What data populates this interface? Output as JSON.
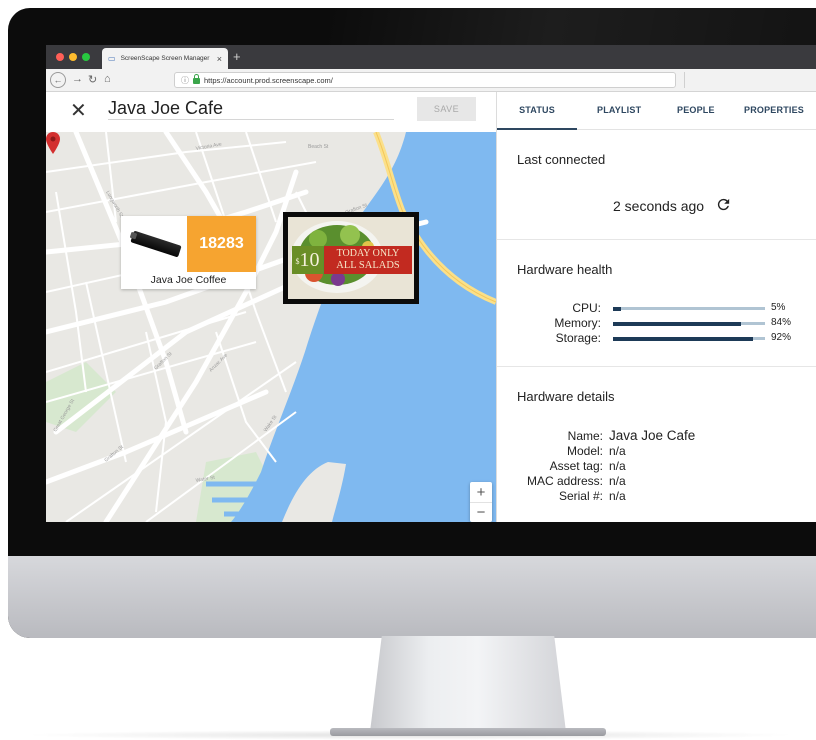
{
  "browser": {
    "tab_title": "ScreenScape Screen Manager",
    "url": "https://account.prod.screenscape.com/"
  },
  "editor": {
    "screen_name": "Java Joe Cafe",
    "save_label": "SAVE"
  },
  "map": {
    "location_card": {
      "count": "18283",
      "name": "Java Joe Coffee"
    },
    "sign": {
      "price_sup": "$",
      "price": "10",
      "line1": "TODAY ONLY",
      "line2": "ALL SALADS"
    },
    "zoom_in": "+",
    "zoom_out": "−"
  },
  "tabs": [
    {
      "label": "STATUS",
      "active": true
    },
    {
      "label": "PLAYLIST",
      "active": false
    },
    {
      "label": "PEOPLE",
      "active": false
    },
    {
      "label": "PROPERTIES",
      "active": false
    }
  ],
  "status": {
    "last_connected": {
      "title": "Last connected",
      "value": "2 seconds ago"
    },
    "hardware_health": {
      "title": "Hardware health",
      "items": [
        {
          "label": "CPU:",
          "value": "5%",
          "percent": 5
        },
        {
          "label": "Memory:",
          "value": "84%",
          "percent": 84
        },
        {
          "label": "Storage:",
          "value": "92%",
          "percent": 92
        }
      ]
    },
    "hardware_details": {
      "title": "Hardware details",
      "items": [
        {
          "label": "Name:",
          "value": "Java Joe Cafe"
        },
        {
          "label": "Model:",
          "value": "n/a"
        },
        {
          "label": "Asset tag:",
          "value": "n/a"
        },
        {
          "label": "MAC address:",
          "value": "n/a"
        },
        {
          "label": "Serial #:",
          "value": "n/a"
        }
      ]
    }
  },
  "colors": {
    "accent": "#2e4760",
    "bar_fill": "#1d3a57",
    "bar_track": "#b0c4d3",
    "count_badge": "#f6a430",
    "pin": "#d32f2f",
    "water": "#7fb9f0"
  }
}
